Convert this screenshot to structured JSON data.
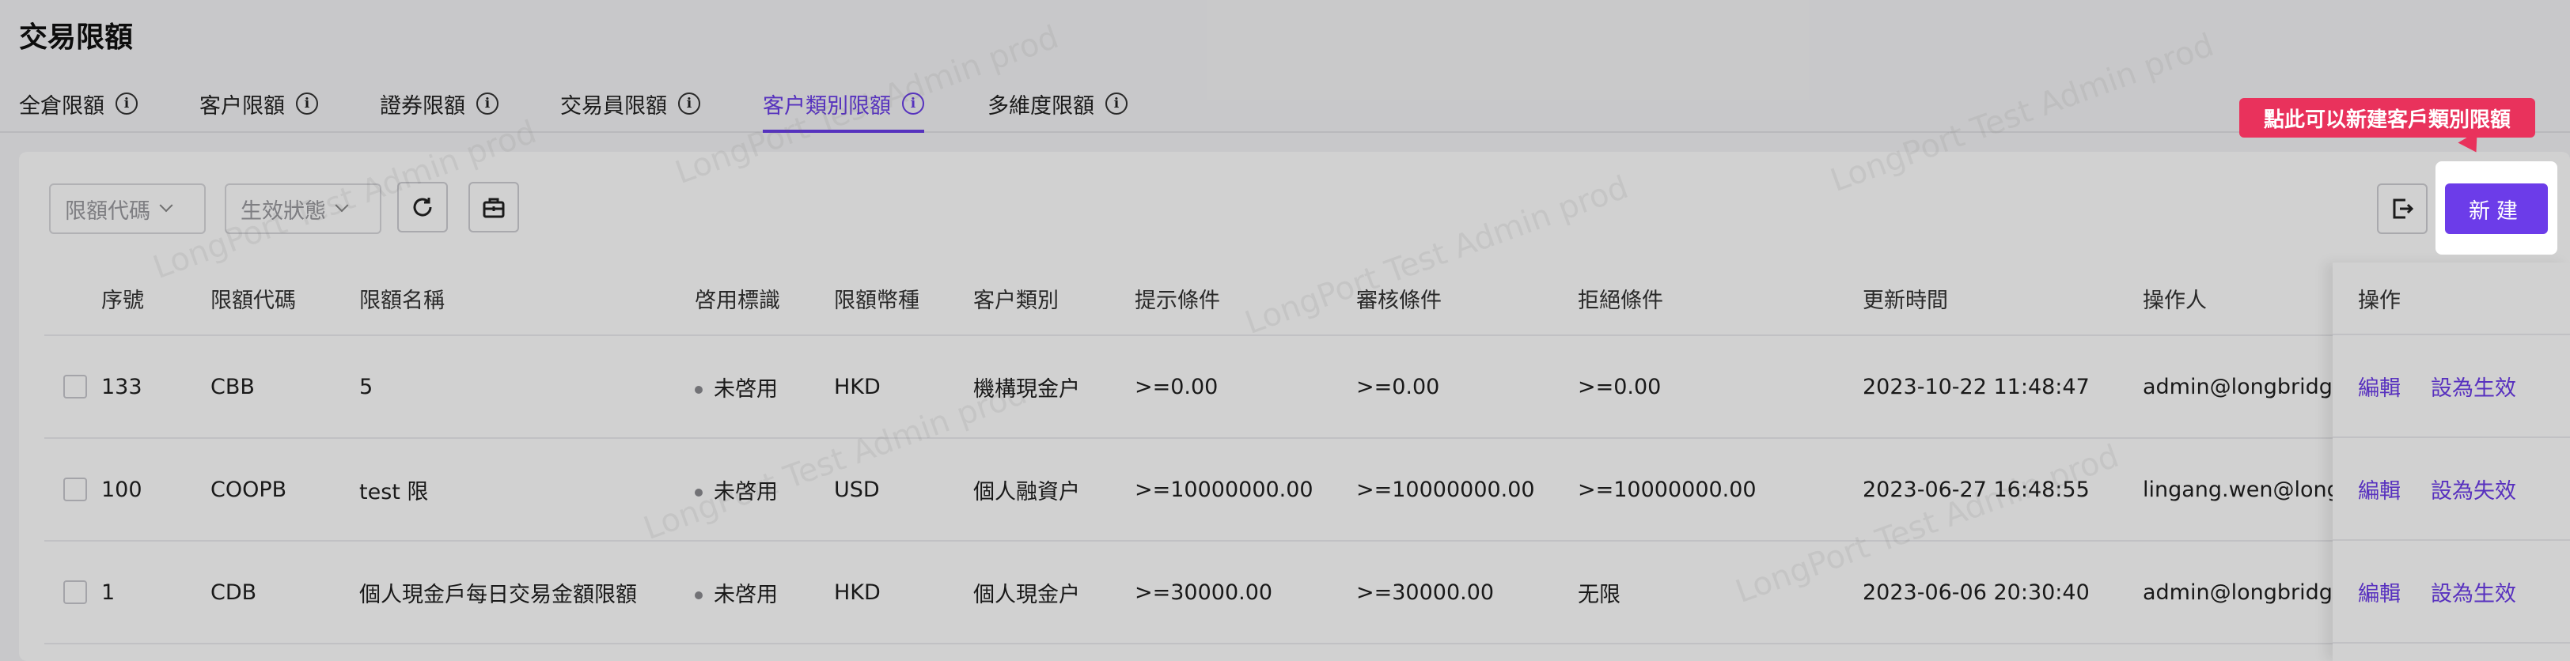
{
  "page": {
    "title": "交易限額"
  },
  "tabs": [
    {
      "label": "全倉限額",
      "active": false
    },
    {
      "label": "客户限額",
      "active": false
    },
    {
      "label": "證券限額",
      "active": false
    },
    {
      "label": "交易員限額",
      "active": false
    },
    {
      "label": "客户類別限額",
      "active": true
    },
    {
      "label": "多維度限額",
      "active": false
    }
  ],
  "filters": {
    "code_placeholder": "限額代碼",
    "status_placeholder": "生效狀態"
  },
  "toolbar": {
    "refresh_icon": "refresh-icon",
    "settings_icon": "toolbox-icon",
    "export_icon": "export-icon",
    "new_label": "新建"
  },
  "tooltip": {
    "text": "點此可以新建客戶類別限額"
  },
  "table": {
    "columns": [
      "序號",
      "限額代碼",
      "限額名稱",
      "啓用標識",
      "限額幣種",
      "客户類別",
      "提示條件",
      "審核條件",
      "拒絕條件",
      "更新時間",
      "操作人",
      "操作"
    ],
    "rows": [
      {
        "seq": "133",
        "code": "CBB",
        "name": "5",
        "status": "未啓用",
        "currency": "HKD",
        "category": "機構現金户",
        "notice": ">=0.00",
        "review": ">=0.00",
        "reject": ">=0.00",
        "updated": "2023-10-22 11:48:47",
        "operator": "admin@longbridge-inc.com",
        "edit": "編輯",
        "toggle": "設為生效"
      },
      {
        "seq": "100",
        "code": "COOPB",
        "name": "test 限",
        "status": "未啓用",
        "currency": "USD",
        "category": "個人融資户",
        "notice": ">=10000000.00",
        "review": ">=10000000.00",
        "reject": ">=10000000.00",
        "updated": "2023-06-27 16:48:55",
        "operator": "lingang.wen@longbridge.sg",
        "edit": "編輯",
        "toggle": "設為失效"
      },
      {
        "seq": "1",
        "code": "CDB",
        "name": "個人現金戶每日交易金額限額",
        "status": "未啓用",
        "currency": "HKD",
        "category": "個人現金户",
        "notice": ">=30000.00",
        "review": ">=30000.00",
        "reject": "无限",
        "updated": "2023-06-06 20:30:40",
        "operator": "admin@longbridge.sg",
        "edit": "編輯",
        "toggle": "設為生效"
      }
    ]
  },
  "watermark": {
    "text": "LongPort Test Admin prod"
  },
  "colors": {
    "accent": "#6c3ce9",
    "tooltip": "#e9325c"
  }
}
